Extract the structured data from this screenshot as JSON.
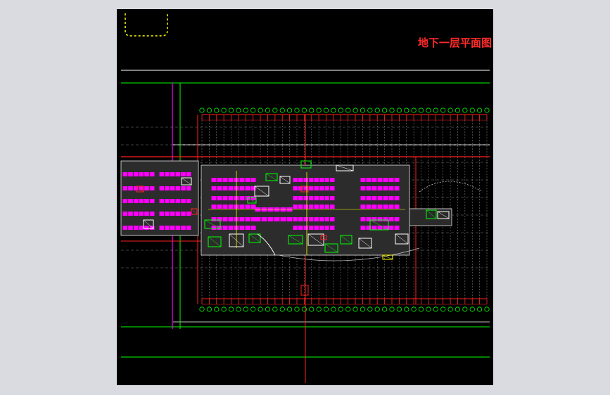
{
  "drawing": {
    "sheet_title": "地下一层平面图",
    "colors": {
      "background": "#000000",
      "viewer": "#d9dbe0",
      "red": "#ff2020",
      "green": "#00ff00",
      "white": "#ffffff",
      "magenta": "#ff00ff",
      "purple": "#b040d0",
      "yellow": "#ffff00",
      "gray": "#bfbfbf",
      "dim": "#7f7f7f"
    },
    "grid_axis_count": 40
  }
}
